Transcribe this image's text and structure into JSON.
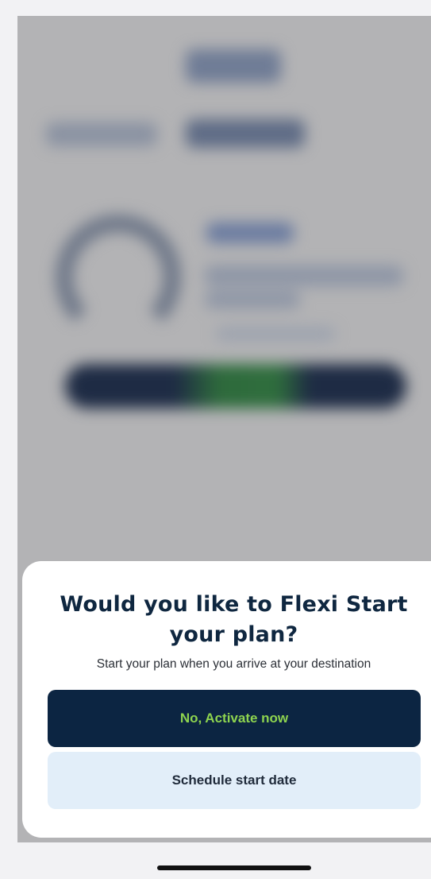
{
  "sheet": {
    "title": "Would you like to Flexi Start your plan?",
    "subtitle": "Start your plan when you arrive at your destination",
    "primary_button": "No, Activate now",
    "secondary_button": "Schedule start date"
  },
  "colors": {
    "navy": "#0c2542",
    "accent_green": "#8ed44f",
    "light_blue": "#e2eef9",
    "overlay_gray": "#b3b3b5"
  }
}
